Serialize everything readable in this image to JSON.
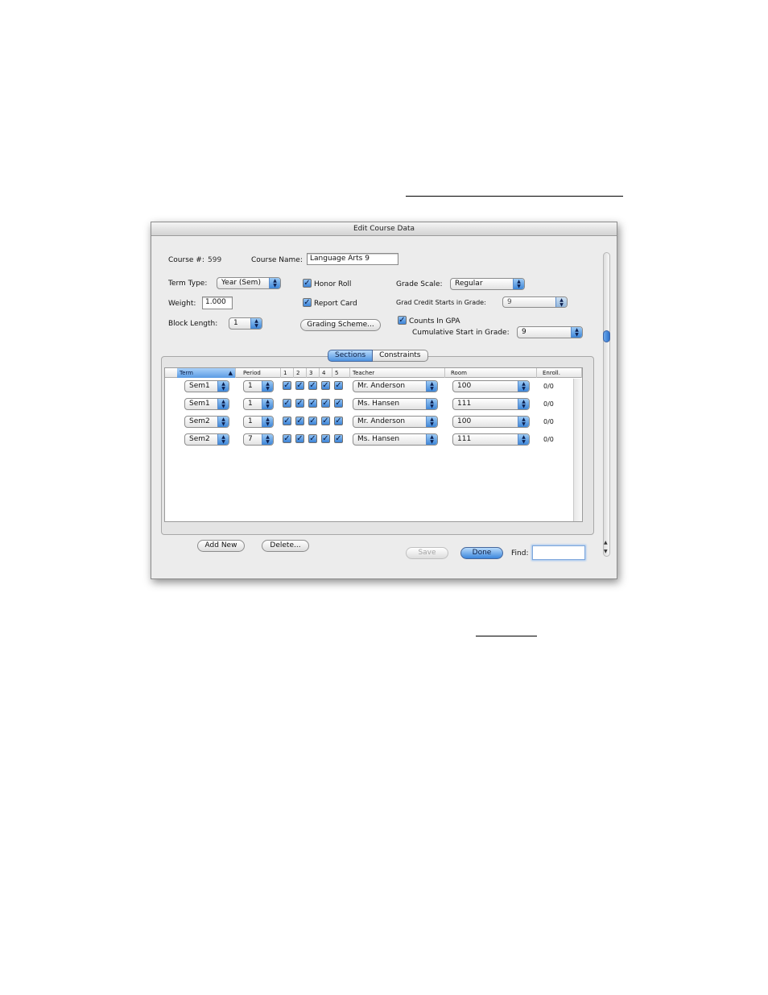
{
  "window": {
    "title": "Edit Course Data"
  },
  "course": {
    "number_label": "Course #:",
    "number_value": "599",
    "name_label": "Course Name:",
    "name_value": "Language Arts 9"
  },
  "fields": {
    "term_type_label": "Term Type:",
    "term_type_value": "Year (Sem)",
    "weight_label": "Weight:",
    "weight_value": "1.000",
    "block_length_label": "Block Length:",
    "block_length_value": "1",
    "honor_roll_label": "Honor Roll",
    "honor_roll_checked": true,
    "report_card_label": "Report Card",
    "report_card_checked": true,
    "grading_scheme_button": "Grading Scheme...",
    "grade_scale_label": "Grade Scale:",
    "grade_scale_value": "Regular",
    "grad_credit_label": "Grad Credit Starts in Grade:",
    "grad_credit_value": "9",
    "counts_gpa_label": "Counts In GPA",
    "counts_gpa_checked": true,
    "cumulative_label": "Cumulative Start in Grade:",
    "cumulative_value": "9"
  },
  "tabs": [
    {
      "label": "Sections",
      "active": true
    },
    {
      "label": "Constraints",
      "active": false
    }
  ],
  "table": {
    "columns": [
      "Term",
      "Period",
      "1",
      "2",
      "3",
      "4",
      "5",
      "Teacher",
      "Room",
      "Enroll."
    ],
    "sorted_column": "Term",
    "rows": [
      {
        "term": "Sem1",
        "period": "1",
        "days": [
          true,
          true,
          true,
          true,
          true
        ],
        "teacher": "Mr. Anderson",
        "room": "100",
        "enroll": "0/0"
      },
      {
        "term": "Sem1",
        "period": "1",
        "days": [
          true,
          true,
          true,
          true,
          true
        ],
        "teacher": "Ms. Hansen",
        "room": "111",
        "enroll": "0/0"
      },
      {
        "term": "Sem2",
        "period": "1",
        "days": [
          true,
          true,
          true,
          true,
          true
        ],
        "teacher": "Mr. Anderson",
        "room": "100",
        "enroll": "0/0"
      },
      {
        "term": "Sem2",
        "period": "7",
        "days": [
          true,
          true,
          true,
          true,
          true
        ],
        "teacher": "Ms. Hansen",
        "room": "111",
        "enroll": "0/0"
      }
    ]
  },
  "footer": {
    "add_new": "Add New",
    "delete": "Delete...",
    "save": "Save",
    "done": "Done",
    "find_label": "Find:",
    "find_value": ""
  },
  "icons": {
    "popup_arrows": "up-down-arrows-icon",
    "check": "checkmark-icon",
    "sort": "sort-ascending-icon"
  },
  "colors": {
    "accent": "#3b86dc",
    "window_bg": "#ececec"
  }
}
